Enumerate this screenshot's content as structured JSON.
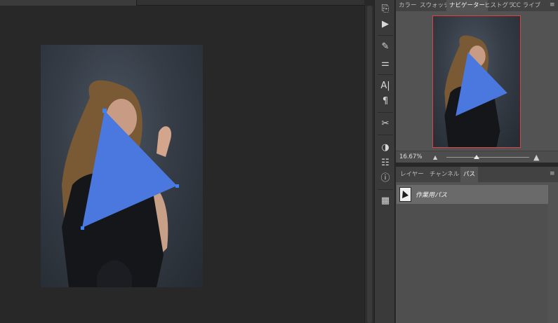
{
  "navigator_tabs": [
    {
      "label": "カラー",
      "active": false
    },
    {
      "label": "スウォッチ",
      "active": false
    },
    {
      "label": "ナビゲーター",
      "active": true
    },
    {
      "label": "ヒストグラ",
      "active": false
    },
    {
      "label": "CC ライブ",
      "active": false
    }
  ],
  "navigator": {
    "zoom_label": "16.67%"
  },
  "paths_tabs": [
    {
      "label": "レイヤー",
      "active": false
    },
    {
      "label": "チャンネル",
      "active": false
    },
    {
      "label": "パス",
      "active": true
    }
  ],
  "paths": {
    "items": [
      {
        "name": "作業用パス",
        "selected": true
      }
    ]
  },
  "tools": [
    {
      "name": "history-icon",
      "glyph": "⎘"
    },
    {
      "name": "actions-play-icon",
      "glyph": "▶"
    },
    {
      "name": "brush-icon",
      "glyph": "✎"
    },
    {
      "name": "brush-settings-icon",
      "glyph": "⚌"
    },
    {
      "name": "character-icon",
      "glyph": "A|"
    },
    {
      "name": "paragraph-icon",
      "glyph": "¶"
    },
    {
      "name": "tool-presets-icon",
      "glyph": "✂"
    },
    {
      "name": "color-icon",
      "glyph": "◑"
    },
    {
      "name": "adjustments-icon",
      "glyph": "☷"
    },
    {
      "name": "info-icon",
      "glyph": "ⓘ"
    },
    {
      "name": "libraries-icon",
      "glyph": "▦"
    }
  ],
  "colors": {
    "path_fill": "#4a78de",
    "anchor": "#3b82f6",
    "nav_frame": "#e04040"
  }
}
